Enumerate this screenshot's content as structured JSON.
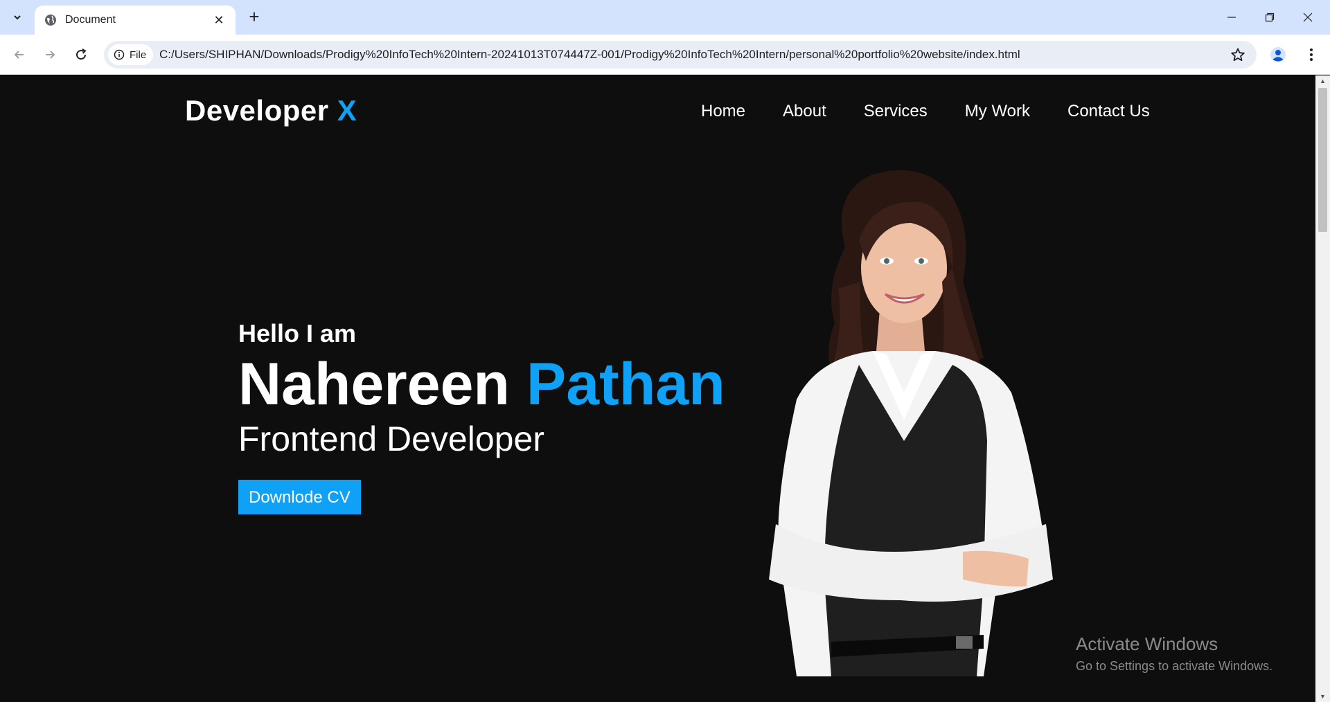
{
  "browser": {
    "tab_title": "Document",
    "address_chip": "File",
    "url": "C:/Users/SHIPHAN/Downloads/Prodigy%20InfoTech%20Intern-20241013T074447Z-001/Prodigy%20InfoTech%20Intern/personal%20portfolio%20website/index.html"
  },
  "site": {
    "logo_main": "Developer",
    "logo_accent": "X",
    "nav": [
      "Home",
      "About",
      "Services",
      "My Work",
      "Contact Us"
    ]
  },
  "hero": {
    "greeting": "Hello I am",
    "first_name": "Nahereen",
    "last_name": "Pathan",
    "role": "Frontend Developer",
    "cta": "Downlode CV"
  },
  "watermark": {
    "line1": "Activate Windows",
    "line2": "Go to Settings to activate Windows."
  },
  "colors": {
    "accent": "#0ea1f6",
    "background": "#0e0e0f",
    "chrome_tabbar": "#d3e3fd"
  }
}
